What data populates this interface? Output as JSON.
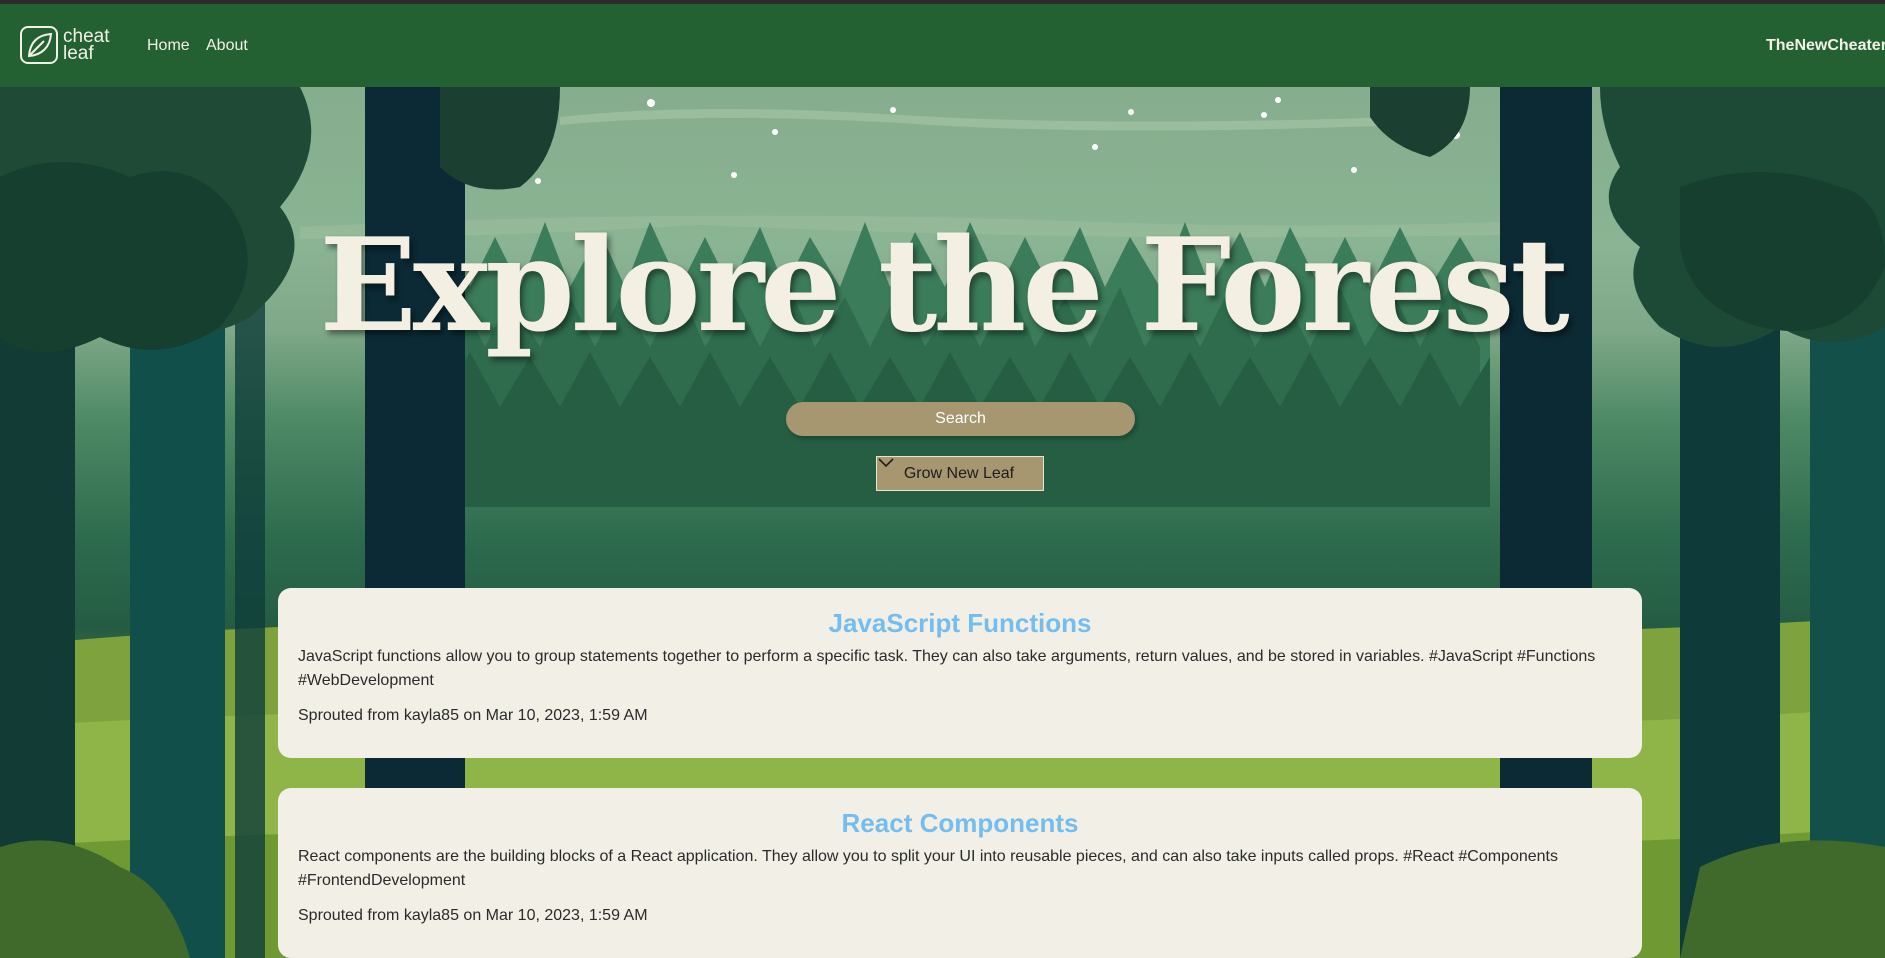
{
  "nav": {
    "logo_line1": "cheat",
    "logo_line2": "leaf",
    "links": [
      "Home",
      "About"
    ],
    "user": "TheNewCheater"
  },
  "hero": {
    "title": "Explore the Forest",
    "search_label": "Search",
    "grow_label": "Grow New Leaf"
  },
  "posts": [
    {
      "title": "JavaScript Functions",
      "body": "JavaScript functions allow you to group statements together to perform a specific task. They can also take arguments, return values, and be stored in variables. #JavaScript #Functions #WebDevelopment",
      "meta": "Sprouted from kayla85 on Mar 10, 2023, 1:59 AM"
    },
    {
      "title": "React Components",
      "body": "React components are the building blocks of a React application. They allow you to split your UI into reusable pieces, and can also take inputs called props. #React #Components #FrontendDevelopment",
      "meta": "Sprouted from kayla85 on Mar 10, 2023, 1:59 AM"
    }
  ],
  "colors": {
    "navbar": "#236133",
    "card_bg": "#f2f0e6",
    "card_title": "#74bdf0",
    "button": "#a69770"
  }
}
